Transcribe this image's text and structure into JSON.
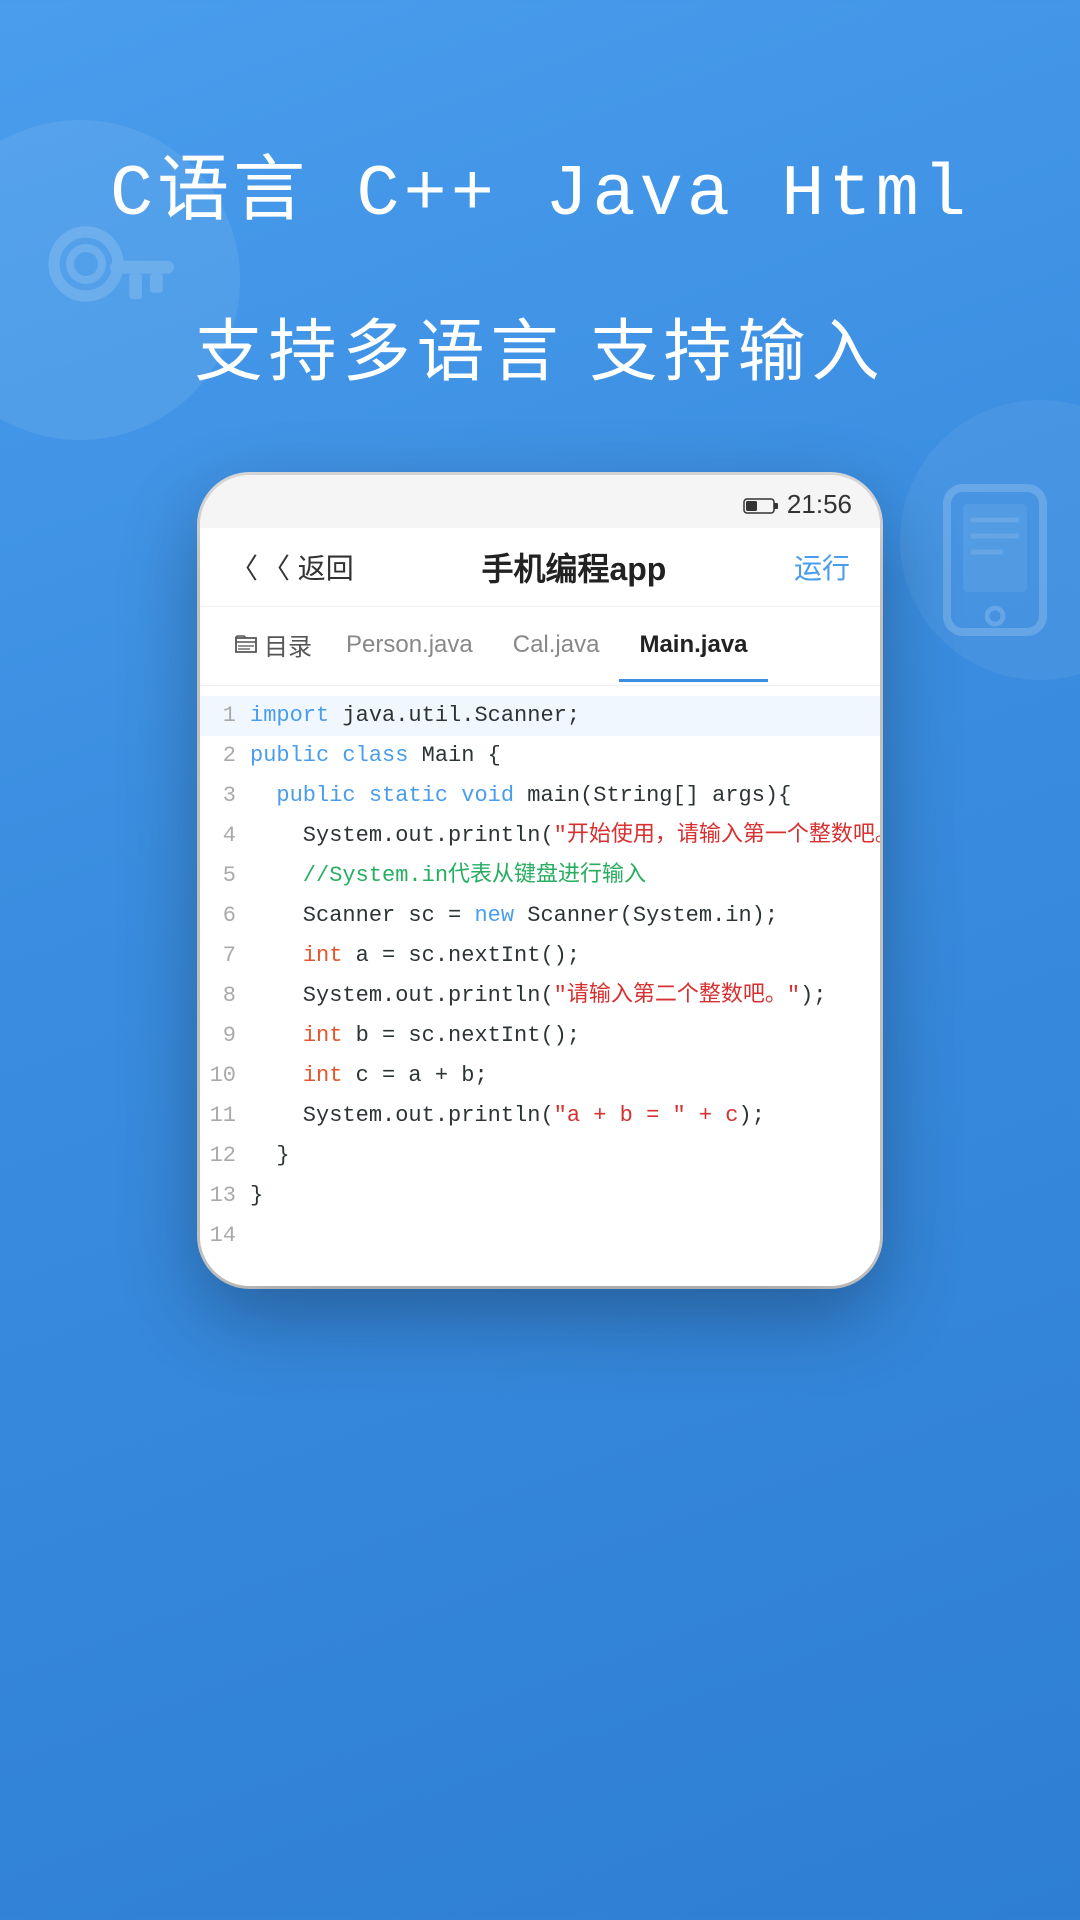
{
  "background": {
    "gradient_start": "#4a9ded",
    "gradient_end": "#2e7fd4"
  },
  "hero": {
    "title": "C语言  C++  Java  Html",
    "subtitle": "支持多语言  支持输入"
  },
  "phone": {
    "status_bar": {
      "battery": "27",
      "time": "21:56"
    },
    "header": {
      "back_label": "〈 返回",
      "title": "手机编程app",
      "run_label": "运行"
    },
    "tabs": {
      "directory_label": "目录",
      "items": [
        {
          "label": "Person.java",
          "active": false
        },
        {
          "label": "Cal.java",
          "active": false
        },
        {
          "label": "Main.java",
          "active": true
        }
      ]
    },
    "code": {
      "lines": [
        {
          "number": "1",
          "tokens": [
            {
              "text": "import ",
              "class": "kw-import"
            },
            {
              "text": "java.util.Scanner;",
              "class": "method-dark"
            }
          ]
        },
        {
          "number": "2",
          "tokens": [
            {
              "text": "public ",
              "class": "kw-blue"
            },
            {
              "text": "class ",
              "class": "kw-blue"
            },
            {
              "text": "Main {",
              "class": "method-dark"
            }
          ]
        },
        {
          "number": "3",
          "tokens": [
            {
              "text": "  public ",
              "class": "kw-blue"
            },
            {
              "text": "static ",
              "class": "kw-blue"
            },
            {
              "text": "void ",
              "class": "kw-blue"
            },
            {
              "text": "main(String[] args){",
              "class": "method-dark"
            }
          ]
        },
        {
          "number": "4",
          "tokens": [
            {
              "text": "    System.out.println(",
              "class": "method-dark"
            },
            {
              "text": "\"开始使用，请输入第一个整数吧。\"",
              "class": "str-red"
            },
            {
              "text": ");",
              "class": "method-dark"
            }
          ]
        },
        {
          "number": "5",
          "tokens": [
            {
              "text": "    //System.in代表从键盘进行输入",
              "class": "comment-green"
            }
          ]
        },
        {
          "number": "6",
          "tokens": [
            {
              "text": "    Scanner sc = ",
              "class": "method-dark"
            },
            {
              "text": "new ",
              "class": "kw-blue"
            },
            {
              "text": "Scanner(System.in);",
              "class": "method-dark"
            }
          ]
        },
        {
          "number": "7",
          "tokens": [
            {
              "text": "    ",
              "class": ""
            },
            {
              "text": "int ",
              "class": "kw-int"
            },
            {
              "text": "a = sc.nextInt();",
              "class": "method-dark"
            }
          ]
        },
        {
          "number": "8",
          "tokens": [
            {
              "text": "    System.out.println(",
              "class": "method-dark"
            },
            {
              "text": "\"请输入第二个整数吧。\"",
              "class": "str-red"
            },
            {
              "text": ");",
              "class": "method-dark"
            }
          ]
        },
        {
          "number": "9",
          "tokens": [
            {
              "text": "    ",
              "class": ""
            },
            {
              "text": "int ",
              "class": "kw-int"
            },
            {
              "text": "b = sc.nextInt();",
              "class": "method-dark"
            }
          ]
        },
        {
          "number": "10",
          "tokens": [
            {
              "text": "    ",
              "class": ""
            },
            {
              "text": "int ",
              "class": "kw-int"
            },
            {
              "text": "c = a + b;",
              "class": "method-dark"
            }
          ]
        },
        {
          "number": "11",
          "tokens": [
            {
              "text": "    System.out.println(",
              "class": "method-dark"
            },
            {
              "text": "\"a + b = \" + c",
              "class": "str-red"
            },
            {
              "text": ");",
              "class": "method-dark"
            }
          ]
        },
        {
          "number": "12",
          "tokens": [
            {
              "text": "  }",
              "class": "method-dark"
            }
          ]
        },
        {
          "number": "13",
          "tokens": [
            {
              "text": "}",
              "class": "method-dark"
            }
          ]
        },
        {
          "number": "14",
          "tokens": [
            {
              "text": "",
              "class": ""
            }
          ]
        }
      ]
    }
  }
}
